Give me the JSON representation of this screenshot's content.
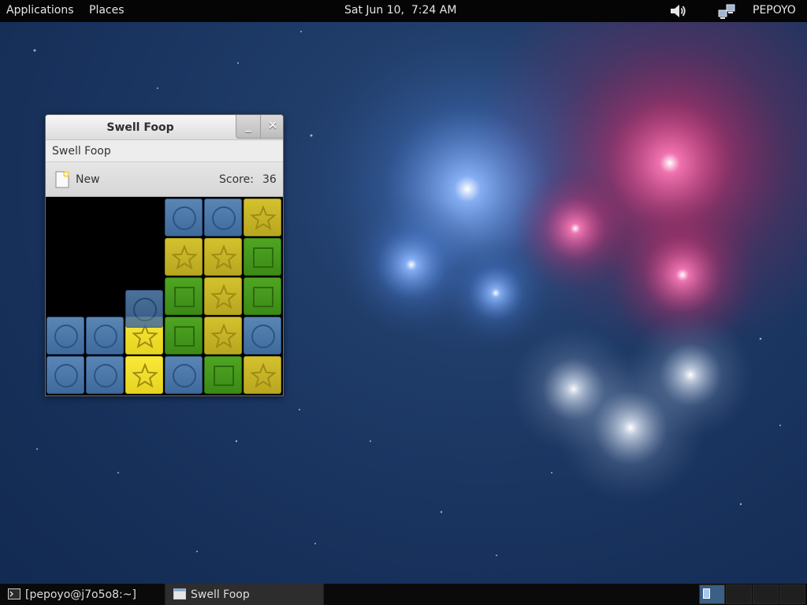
{
  "top_panel": {
    "applications": "Applications",
    "places": "Places",
    "clock": "Sat Jun 10,  7:24 AM",
    "volume_icon": "volume-icon",
    "network_icon": "network-icon",
    "user": "PEPOYO"
  },
  "window": {
    "title": "Swell Foop",
    "minimize_glyph": "_",
    "close_glyph": "✕",
    "app_menu": "Swell Foop",
    "new_label": "New",
    "score_label": "Score:",
    "score_value": "36"
  },
  "board": {
    "columns": 6,
    "rows": 5,
    "colors": {
      "blue": "#4a76a8",
      "yellow": "#c9b626",
      "green": "#44981c"
    },
    "grid": [
      [
        null,
        null,
        null,
        "blue-circle",
        "blue-circle",
        "yellow-star"
      ],
      [
        null,
        null,
        null,
        "yellow-star",
        "yellow-star",
        "green-square"
      ],
      [
        null,
        null,
        null,
        "green-square",
        "yellow-star",
        "green-square"
      ],
      [
        "blue-circle",
        "blue-circle",
        "yellow-star",
        "green-square",
        "yellow-star",
        "blue-circle"
      ],
      [
        "blue-circle",
        "blue-circle",
        "yellow-star",
        "blue-circle",
        "green-square",
        "yellow-star"
      ]
    ],
    "highlighted_column": 2,
    "falling_tile": "blue-circle"
  },
  "bottom_panel": {
    "tasks": [
      {
        "label": "[pepoyo@j7o5o8:~]",
        "icon": "terminal-icon"
      },
      {
        "label": "Swell Foop",
        "icon": "window-icon"
      }
    ],
    "workspaces": 4,
    "active_workspace": 1
  }
}
